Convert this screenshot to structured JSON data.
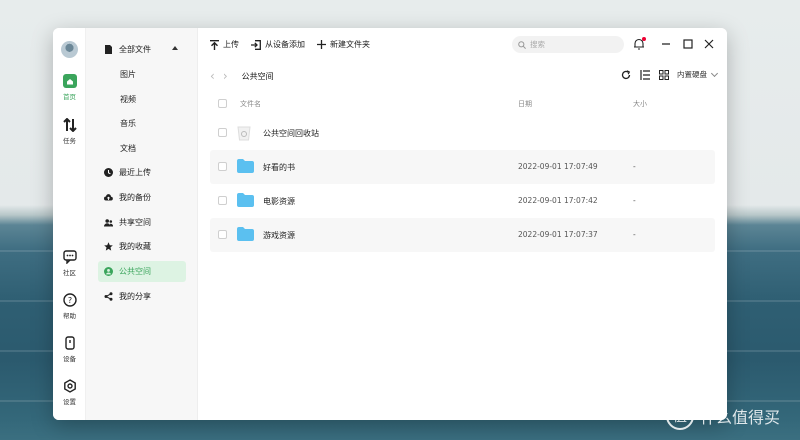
{
  "rail": {
    "items": [
      {
        "label": "首页",
        "icon": "home-icon"
      },
      {
        "label": "任务",
        "icon": "transfer-icon"
      },
      {
        "label": "社区",
        "icon": "chat-icon"
      },
      {
        "label": "帮助",
        "icon": "help-icon"
      },
      {
        "label": "设备",
        "icon": "device-icon"
      },
      {
        "label": "设置",
        "icon": "gear-icon"
      }
    ]
  },
  "sidebar": {
    "all_files": "全部文件",
    "sub": [
      "图片",
      "视频",
      "音乐",
      "文档"
    ],
    "items": [
      {
        "label": "最近上传",
        "icon": "clock-icon"
      },
      {
        "label": "我的备份",
        "icon": "cloud-upload-icon"
      },
      {
        "label": "共享空间",
        "icon": "users-icon"
      },
      {
        "label": "我的收藏",
        "icon": "star-icon"
      },
      {
        "label": "公共空间",
        "icon": "public-icon"
      },
      {
        "label": "我的分享",
        "icon": "share-icon"
      }
    ]
  },
  "toolbar": {
    "upload": "上传",
    "add_from_device": "从设备添加",
    "new_folder": "新建文件夹",
    "search_placeholder": "搜索"
  },
  "pathbar": {
    "current": "公共空间",
    "disk": "内置硬盘"
  },
  "table": {
    "headers": {
      "name": "文件名",
      "date": "日期",
      "size": "大小"
    },
    "rows": [
      {
        "name": "公共空间回收站",
        "date": "",
        "size": "",
        "type": "recycle"
      },
      {
        "name": "好看的书",
        "date": "2022-09-01 17:07:49",
        "size": "-",
        "type": "folder"
      },
      {
        "name": "电影资源",
        "date": "2022-09-01 17:07:42",
        "size": "-",
        "type": "folder"
      },
      {
        "name": "游戏资源",
        "date": "2022-09-01 17:07:37",
        "size": "-",
        "type": "folder"
      }
    ]
  },
  "colors": {
    "accent": "#3ba55c",
    "active_bg": "#ddf3e3",
    "folder": "#5bc0f0"
  },
  "watermark": {
    "badge": "值",
    "text": "什么值得买"
  }
}
